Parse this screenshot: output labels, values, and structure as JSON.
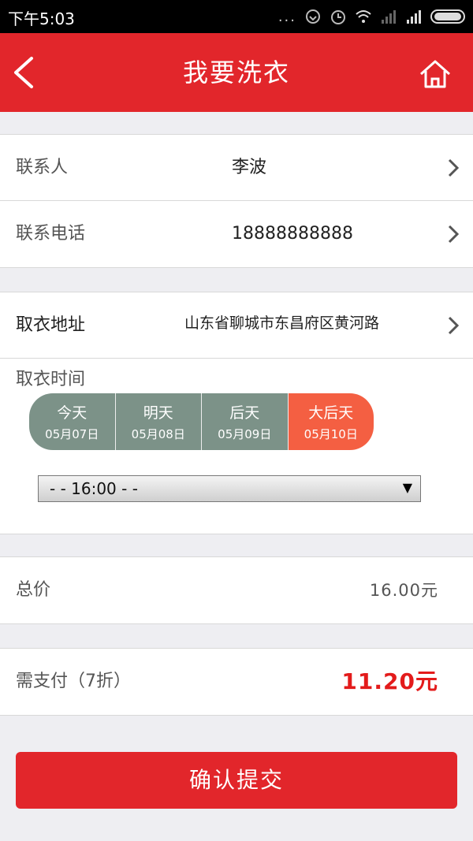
{
  "statusbar": {
    "time": "下午5:03",
    "dots": "..."
  },
  "header": {
    "title": "我要洗衣",
    "back_icon": "chevron-left-icon",
    "home_icon": "home-icon"
  },
  "contact": {
    "name_label": "联系人",
    "name_value": "李波",
    "phone_label": "联系电话",
    "phone_value": "18888888888"
  },
  "pickup": {
    "address_label": "取衣地址",
    "address_value": "山东省聊城市东昌府区黄河路",
    "time_label": "取衣时间",
    "days": [
      {
        "name": "今天",
        "date": "05月07日"
      },
      {
        "name": "明天",
        "date": "05月08日"
      },
      {
        "name": "后天",
        "date": "05月09日"
      },
      {
        "name": "大后天",
        "date": "05月10日"
      }
    ],
    "selected_day": "大后天",
    "time_select_value": "-  - 16:00 -  -"
  },
  "total": {
    "label": "总价",
    "value": "16.00元"
  },
  "payment": {
    "label": "需支付（7折）",
    "value": "11.20元"
  },
  "submit_label": "确认提交",
  "colors": {
    "brand_red": "#e2262b",
    "tab_gray": "#7c9288",
    "tab_active": "#f45f42",
    "price_red": "#e31b1b"
  }
}
